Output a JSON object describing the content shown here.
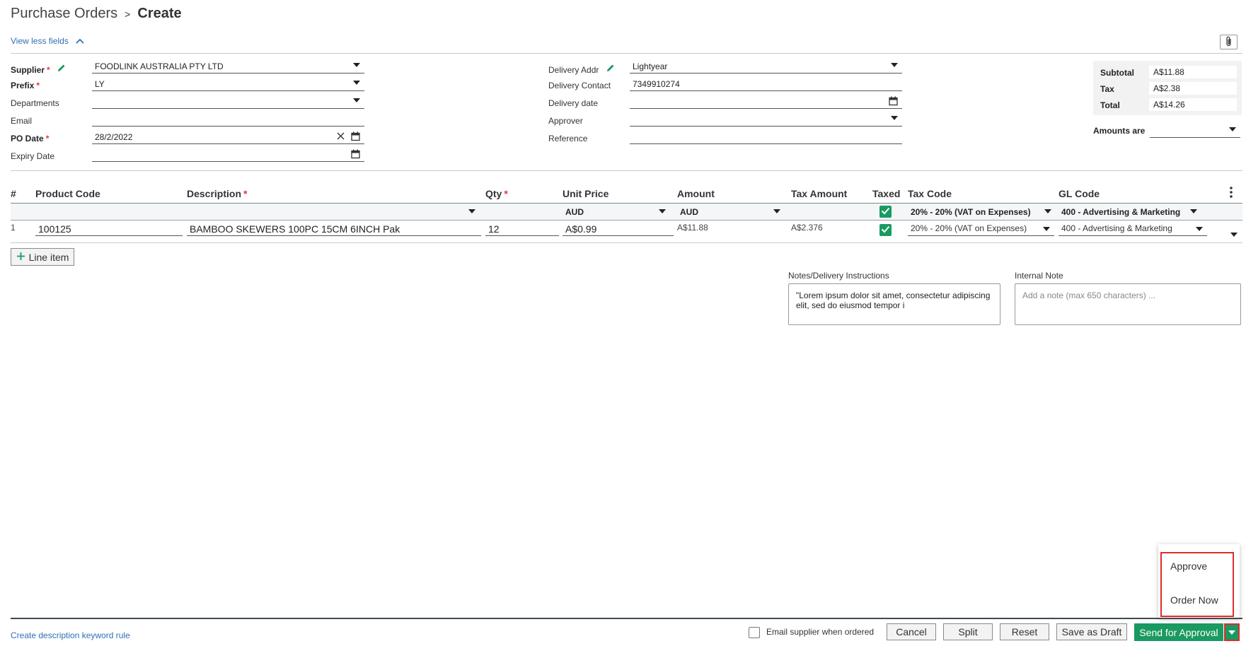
{
  "breadcrumb": {
    "parent": "Purchase Orders",
    "separator": ">",
    "current": "Create"
  },
  "view_toggle": "View less fields",
  "left_fields": {
    "supplier": {
      "label": "Supplier",
      "value": "FOODLINK AUSTRALIA PTY LTD"
    },
    "prefix": {
      "label": "Prefix",
      "value": "LY"
    },
    "departments": {
      "label": "Departments",
      "value": ""
    },
    "email": {
      "label": "Email",
      "value": ""
    },
    "po_date": {
      "label": "PO Date",
      "value": "28/2/2022"
    },
    "expiry_date": {
      "label": "Expiry Date",
      "value": ""
    }
  },
  "right_fields": {
    "delivery_addr": {
      "label": "Delivery Addr",
      "value": "Lightyear"
    },
    "delivery_contact": {
      "label": "Delivery Contact",
      "value": "7349910274"
    },
    "delivery_date": {
      "label": "Delivery date",
      "value": ""
    },
    "approver": {
      "label": "Approver",
      "value": ""
    },
    "reference": {
      "label": "Reference",
      "value": ""
    }
  },
  "required_mark": "*",
  "totals": {
    "subtotal_label": "Subtotal",
    "subtotal": "A$11.88",
    "tax_label": "Tax",
    "tax": "A$2.38",
    "total_label": "Total",
    "total": "A$14.26",
    "amounts_are_label": "Amounts are",
    "amounts_are": ""
  },
  "table": {
    "headers": {
      "num": "#",
      "product_code": "Product Code",
      "description": "Description",
      "qty": "Qty",
      "unit_price": "Unit Price",
      "amount": "Amount",
      "tax_amount": "Tax Amount",
      "taxed": "Taxed",
      "tax_code": "Tax Code",
      "gl_code": "GL Code"
    },
    "defaults": {
      "unit_price_currency": "AUD",
      "amount_currency": "AUD",
      "tax_code": "20% - 20% (VAT on Expenses)",
      "gl_code": "400 - Advertising & Marketing"
    },
    "rows": [
      {
        "num": "1",
        "product_code": "100125",
        "description": "BAMBOO SKEWERS 100PC 15CM 6INCH Pak",
        "qty": "12",
        "unit_price": "A$0.99",
        "amount": "A$11.88",
        "tax_amount": "A$2.376",
        "tax_code": "20% - 20% (VAT on Expenses)",
        "gl_code": "400 - Advertising & Marketing"
      }
    ]
  },
  "add_line_label": "Line item",
  "notes": {
    "delivery_label": "Notes/Delivery Instructions",
    "delivery_value": "\"Lorem ipsum dolor sit amet, consectetur adipiscing elit, sed do eiusmod tempor i",
    "internal_label": "Internal Note",
    "internal_placeholder": "Add a note (max 650 characters) ..."
  },
  "footer": {
    "keyword_rule_link": "Create description keyword rule",
    "email_supplier_label": "Email supplier when ordered",
    "cancel": "Cancel",
    "split": "Split",
    "reset": "Reset",
    "save_draft": "Save as Draft",
    "send_approval": "Send for Approval"
  },
  "approval_menu": {
    "approve": "Approve",
    "order_now": "Order Now"
  },
  "colors": {
    "primary": "#1a9a62",
    "link": "#2f6fb7",
    "required": "#e53935",
    "highlight": "#e02b2b"
  },
  "icons": {
    "supplier_edit": "pencil-icon",
    "delivery_edit": "pencil-icon",
    "date_picker": "calendar-icon",
    "clear": "close-icon",
    "attach": "paperclip-icon",
    "more": "kebab-icon",
    "add": "plus-icon",
    "dropdown": "caret-down-icon"
  }
}
